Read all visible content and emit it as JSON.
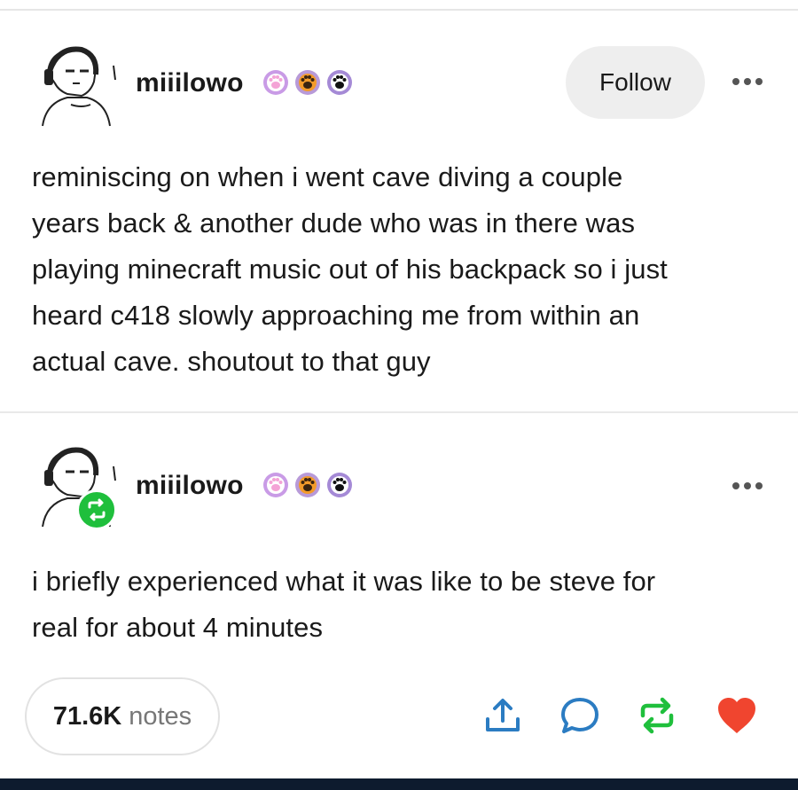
{
  "post": {
    "username": "miiilowo",
    "follow_label": "Follow",
    "text_lines": [
      "reminiscing on when i went cave diving a couple",
      "years back & another dude who was in there was",
      "playing minecraft music out of his backpack so i just",
      "heard c418 slowly approaching me from within an",
      "actual cave. shoutout to that guy"
    ]
  },
  "reblog": {
    "username": "miiilowo",
    "text_lines": [
      "i briefly experienced what it was like to be steve for",
      "real for about 4 minutes"
    ]
  },
  "footer": {
    "notes_count": "71.6K",
    "notes_label": "notes"
  },
  "badges": [
    {
      "icon": "paw-pink-icon",
      "bg": "#c99be6",
      "fg": "#f4a3d6"
    },
    {
      "icon": "paw-orange-icon",
      "bg": "#b89ad8",
      "fg": "#f39b2a"
    },
    {
      "icon": "paw-black-icon",
      "bg": "#a58ad6",
      "fg": "#111111"
    }
  ],
  "colors": {
    "reblog_green": "#1fbf3c",
    "heart_red": "#f0452f",
    "action_blue": "#2b7cc2"
  }
}
